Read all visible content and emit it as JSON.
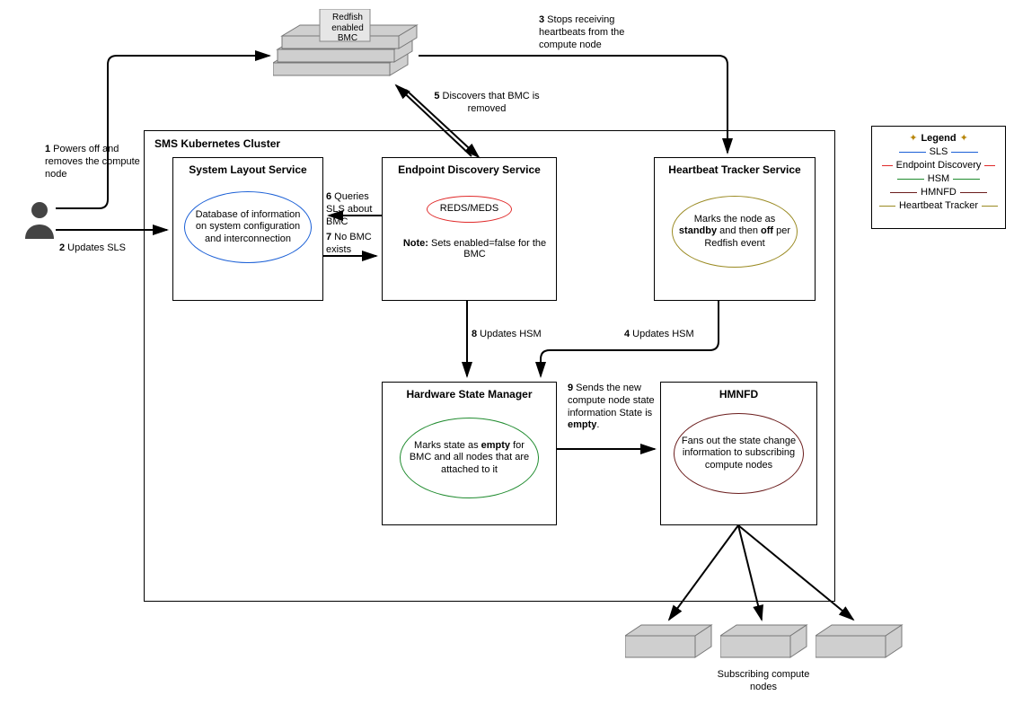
{
  "bmc": {
    "label": "Redfish enabled BMC"
  },
  "cluster": {
    "label": "SMS Kubernetes Cluster"
  },
  "sls": {
    "title": "System Layout Service",
    "ellipse": "Database of information on system configuration and interconnection"
  },
  "eds": {
    "title": "Endpoint Discovery Service",
    "ellipse": "REDS/MEDS",
    "note_prefix": "Note:",
    "note_body": " Sets enabled=false for the BMC"
  },
  "hts": {
    "title": "Heartbeat Tracker Service",
    "ellipse_pre": "Marks the node as ",
    "ellipse_b1": "standby",
    "ellipse_mid": " and then ",
    "ellipse_b2": "off",
    "ellipse_post": " per Redfish event"
  },
  "hsm": {
    "title": "Hardware State Manager",
    "ellipse_pre": "Marks state as ",
    "ellipse_b": "empty",
    "ellipse_post": " for BMC and all nodes that are attached to it"
  },
  "hmnfd": {
    "title": "HMNFD",
    "ellipse": "Fans out the state change information to subscribing compute nodes"
  },
  "labels": {
    "l1_n": "1",
    "l1": " Powers off and removes the compute node",
    "l2_n": "2",
    "l2": " Updates SLS",
    "l3_n": "3",
    "l3": " Stops receiving heartbeats from the compute node",
    "l4_n": "4",
    "l4": " Updates HSM",
    "l5_n": "5",
    "l5": " Discovers that BMC is removed",
    "l6_n": "6",
    "l6": " Queries SLS about BMC",
    "l7_n": "7",
    "l7": " No BMC exists",
    "l8_n": "8",
    "l8": " Updates HSM",
    "l9_n": "9",
    "l9_pre": " Sends the new compute node state information State is ",
    "l9_b": "empty",
    "l9_post": "."
  },
  "subscribers": "Subscribing compute nodes",
  "legend": {
    "title": "Legend",
    "sls": "SLS",
    "ed": "Endpoint Discovery",
    "hsm": "HSM",
    "hmnfd": "HMNFD",
    "ht": "Heartbeat Tracker"
  },
  "colors": {
    "sls": "#1a5fd6",
    "ed": "#e02a2a",
    "hsm": "#1f8b2e",
    "hmnfd": "#6b1d1d",
    "ht": "#9a8a22"
  }
}
